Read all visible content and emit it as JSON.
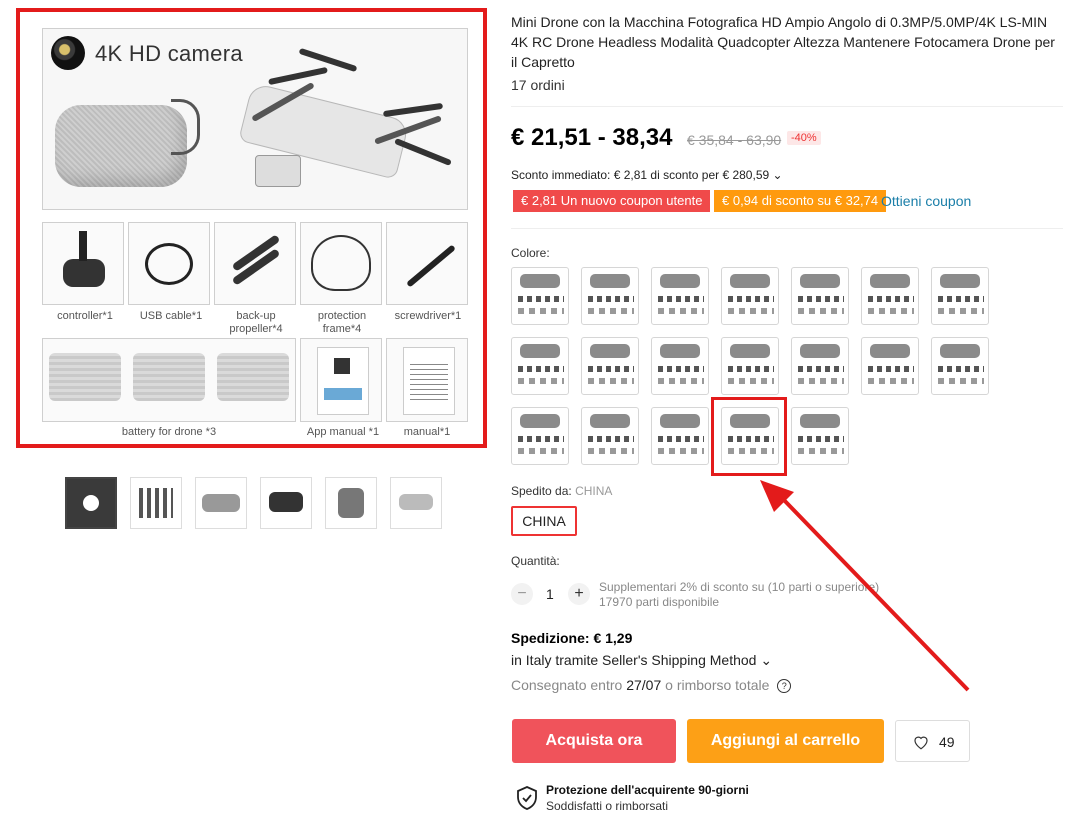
{
  "gallery": {
    "main_image": {
      "camera_text": "4K HD camera",
      "captions": {
        "controller": "controller*1",
        "usb": "USB cable*1",
        "propeller_1": "back-up",
        "propeller_2": "propeller*4",
        "frame_1": "protection",
        "frame_2": "frame*4",
        "screwdriver": "screwdriver*1",
        "battery": "battery for drone *3",
        "app_manual": "App manual *1",
        "manual": "manual*1"
      }
    },
    "thumbnail_count": 6
  },
  "product": {
    "title": "Mini Drone con la Macchina Fotografica HD Ampio Angolo di 0.3MP/5.0MP/4K LS-MIN 4K RC Drone Headless Modalità Quadcopter Altezza Mantenere Fotocamera Drone per il Capretto",
    "orders": "17 ordini",
    "price": "€ 21,51 - 38,34",
    "old_price": "€ 35,84 - 63,90",
    "discount": "-40%",
    "immediate_discount": "Sconto immediato: € 2,81 di sconto per € 280,59 ⌄",
    "coupon_new_user": "€ 2,81 Un nuovo coupon utente",
    "coupon_spend": "€ 0,94 di sconto su € 32,74",
    "get_coupon": "Ottieni coupon",
    "color_label": "Colore:",
    "color_option_count": 19,
    "selected_color_index": 17,
    "ship_from_label": "Spedito da:",
    "ship_from_value": "CHINA",
    "country_button": "CHINA",
    "quantity_label": "Quantità:",
    "quantity": "1",
    "minus": "−",
    "plus": "+",
    "qty_note_1": "Supplementari 2% di sconto su (10 parti o superiore)",
    "qty_note_2": "17970 parti disponibile",
    "shipping_title": "Spedizione: € 1,29",
    "shipping_method": "in Italy tramite Seller's Shipping Method ⌄",
    "delivery_prefix": "Consegnato entro",
    "delivery_date": "27/07",
    "delivery_suffix": "o rimborso totale",
    "help": "?",
    "buy_now": "Acquista ora",
    "add_to_cart": "Aggiungi al carrello",
    "wishlist_count": "49",
    "protection_title": "Protezione dell'acquirente 90-giorni",
    "protection_sub": "Soddisfatti o rimborsati"
  },
  "colors": {
    "accent_red": "#e31b1b",
    "buy_button": "#f0535b",
    "cart_button": "#fda016",
    "coupon_red": "#f04a4a",
    "coupon_orange": "#ff9a0e",
    "link": "#1a7ea8"
  }
}
